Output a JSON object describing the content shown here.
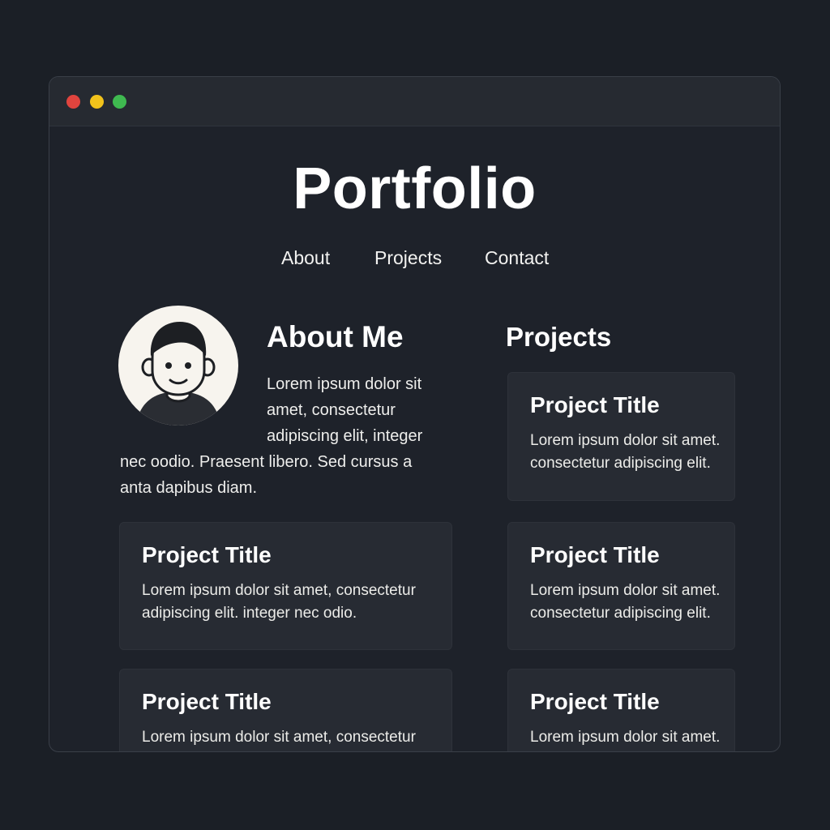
{
  "window": {
    "controls": [
      {
        "name": "close",
        "color": "#e0443e"
      },
      {
        "name": "minimize",
        "color": "#f1c21b"
      },
      {
        "name": "maximize",
        "color": "#3fb950"
      }
    ]
  },
  "header": {
    "title": "Portfolio",
    "nav": [
      "About",
      "Projects",
      "Contact"
    ]
  },
  "about": {
    "heading": "About Me",
    "avatar_icon": "user-avatar-icon",
    "text_lines": [
      "Lorem ipsum dolor sit",
      "amet, consectetur",
      "adipiscing elit, integer",
      "nec oodio. Praesent libero. Sed cursus a",
      "anta dapibus diam."
    ]
  },
  "projects": {
    "heading": "Projects",
    "left_cards": [
      {
        "title": "Project Title",
        "description": "Lorem ipsum dolor sit amet, consectetur adipiscing elit. integer nec odio."
      },
      {
        "title": "Project Title",
        "description": "Lorem ipsum dolor sit amet, consectetur adipiscing elit. integer nec odio."
      }
    ],
    "right_cards": [
      {
        "title": "Project Title",
        "description": "Lorem ipsum dolor sit amet. consectetur adipiscing elit."
      },
      {
        "title": "Project Title",
        "description": "Lorem ipsum dolor sit amet. consectetur adipiscing elit."
      },
      {
        "title": "Project Title",
        "description": "Lorem ipsum dolor sit amet. consectetur adipiscing elit."
      }
    ]
  },
  "colors": {
    "page_background": "#1b1f26",
    "window_background": "#1e222a",
    "card_background": "#272b33",
    "avatar_background": "#f7f4ee"
  }
}
